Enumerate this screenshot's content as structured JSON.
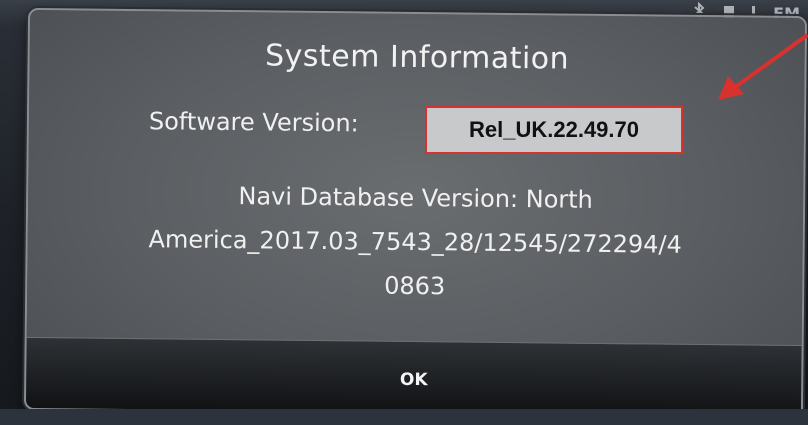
{
  "status_bar": {
    "icons": [
      "bluetooth-icon",
      "signal-icon"
    ],
    "partial_text": "FM"
  },
  "dialog": {
    "title": "System Information",
    "software_version_label": "Software Version:",
    "software_version_value": "Rel_UK.22.49.70",
    "navi_line_1": "Navi Database Version: North",
    "navi_line_2": "America_2017.03_7543_28/12545/272294/4",
    "navi_line_3": "0863",
    "ok_label": "OK"
  },
  "annotation": {
    "arrow_color": "#d9322e",
    "box_border_color": "#d9322e"
  }
}
